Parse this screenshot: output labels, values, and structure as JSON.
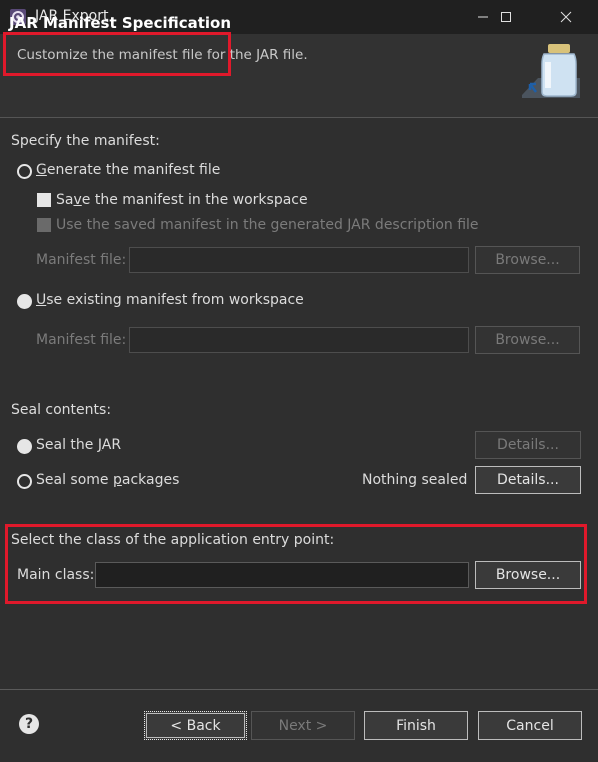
{
  "window": {
    "title": "JAR Export",
    "icon": "eclipse-gear-icon",
    "controls": [
      "minimize",
      "maximize",
      "close"
    ]
  },
  "header": {
    "title": "JAR Manifest Specification",
    "description": "Customize the manifest file for the JAR file.",
    "icon": "jar-icon"
  },
  "manifest": {
    "section_label": "Specify the manifest:",
    "generate": {
      "label": "Generate the manifest file",
      "mnemonic": "G",
      "selected": false
    },
    "save_in_workspace": {
      "label": "Save the manifest in the workspace",
      "mnemonic": "v",
      "checked": true
    },
    "use_saved": {
      "label": "Use the saved manifest in the generated JAR description file",
      "enabled": false
    },
    "manifest_file_1": {
      "label": "Manifest file:",
      "value": "",
      "browse": "Browse..."
    },
    "use_existing": {
      "label": "Use existing manifest from workspace",
      "mnemonic": "U",
      "selected": true
    },
    "manifest_file_2": {
      "label": "Manifest file:",
      "value": "",
      "browse": "Browse..."
    }
  },
  "seal": {
    "section_label": "Seal contents:",
    "seal_jar": {
      "label": "Seal the JAR",
      "mnemonic": "J",
      "selected": true,
      "details": "Details..."
    },
    "seal_some": {
      "label": "Seal some packages",
      "mnemonic": "p",
      "selected": false,
      "status": "Nothing sealed",
      "details": "Details..."
    }
  },
  "entry_point": {
    "section_label": "Select the class of the application entry point:",
    "main_class_label": "Main class:",
    "main_class_value": "",
    "browse": "Browse..."
  },
  "footer": {
    "help_icon": "question-mark-icon",
    "help_glyph": "?",
    "back": "< Back",
    "next": "Next >",
    "finish": "Finish",
    "cancel": "Cancel"
  },
  "colors": {
    "highlight": "#e0192b",
    "background": "#2f2f2f",
    "titlebar": "#202020"
  }
}
